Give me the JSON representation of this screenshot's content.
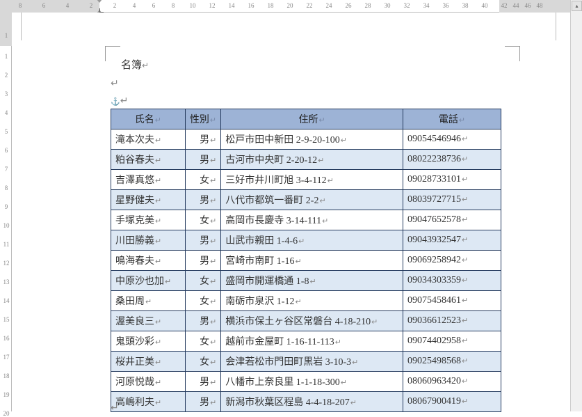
{
  "ruler": {
    "corner": "L",
    "h_numbers": [
      "8",
      "6",
      "4",
      "2",
      "2",
      "4",
      "6",
      "8",
      "10",
      "12",
      "14",
      "16",
      "18",
      "20",
      "22",
      "24",
      "26",
      "28",
      "30",
      "32",
      "34",
      "36",
      "38",
      "40",
      "42",
      "44",
      "46",
      "48"
    ],
    "v_numbers": [
      "1",
      "1",
      "2",
      "3",
      "4",
      "5",
      "6",
      "7",
      "8",
      "9",
      "10",
      "11",
      "12",
      "13",
      "14",
      "15",
      "16",
      "17",
      "18",
      "19",
      "20"
    ]
  },
  "document": {
    "title": "名簿",
    "table": {
      "headers": {
        "name": "氏名",
        "gender": "性別",
        "address": "住所",
        "phone": "電話"
      },
      "rows": [
        {
          "name": "滝本次夫",
          "gender": "男",
          "address": "松戸市田中新田 2-9-20-100",
          "phone": "09054546946"
        },
        {
          "name": "粕谷春夫",
          "gender": "男",
          "address": "古河市中央町 2-20-12",
          "phone": "08022238736"
        },
        {
          "name": "吉澤真悠",
          "gender": "女",
          "address": "三好市井川町旭 3-4-112",
          "phone": "09028733101"
        },
        {
          "name": "星野健夫",
          "gender": "男",
          "address": "八代市都筑一番町 2-2",
          "phone": "08039727715"
        },
        {
          "name": "手塚克美",
          "gender": "女",
          "address": "高岡市長慶寺 3-14-111",
          "phone": "09047652578"
        },
        {
          "name": "川田勝義",
          "gender": "男",
          "address": "山武市親田 1-4-6",
          "phone": "09043932547"
        },
        {
          "name": "鳴海春夫",
          "gender": "男",
          "address": "宮崎市南町 1-16",
          "phone": "09069258942"
        },
        {
          "name": "中原沙也加",
          "gender": "女",
          "address": "盛岡市開運橋通 1-8",
          "phone": "09034303359"
        },
        {
          "name": "桑田周",
          "gender": "女",
          "address": "南砺市泉沢 1-12",
          "phone": "09075458461"
        },
        {
          "name": "渥美良三",
          "gender": "男",
          "address": "横浜市保土ヶ谷区常磐台 4-18-210",
          "phone": "09036612523"
        },
        {
          "name": "鬼頭沙彩",
          "gender": "女",
          "address": "越前市金屋町 1-16-11-113",
          "phone": "09074402958"
        },
        {
          "name": "桜井正美",
          "gender": "女",
          "address": "会津若松市門田町黒岩 3-10-3",
          "phone": "09025498568"
        },
        {
          "name": "河原悦哉",
          "gender": "男",
          "address": "八幡市上奈良里 1-1-18-300",
          "phone": "08060963420"
        },
        {
          "name": "高嶋利夫",
          "gender": "男",
          "address": "新潟市秋葉区程島 4-4-18-207",
          "phone": "08067900419"
        }
      ]
    }
  },
  "marks": {
    "para": "↵",
    "anchor": "⚓",
    "rowend": "↵"
  }
}
